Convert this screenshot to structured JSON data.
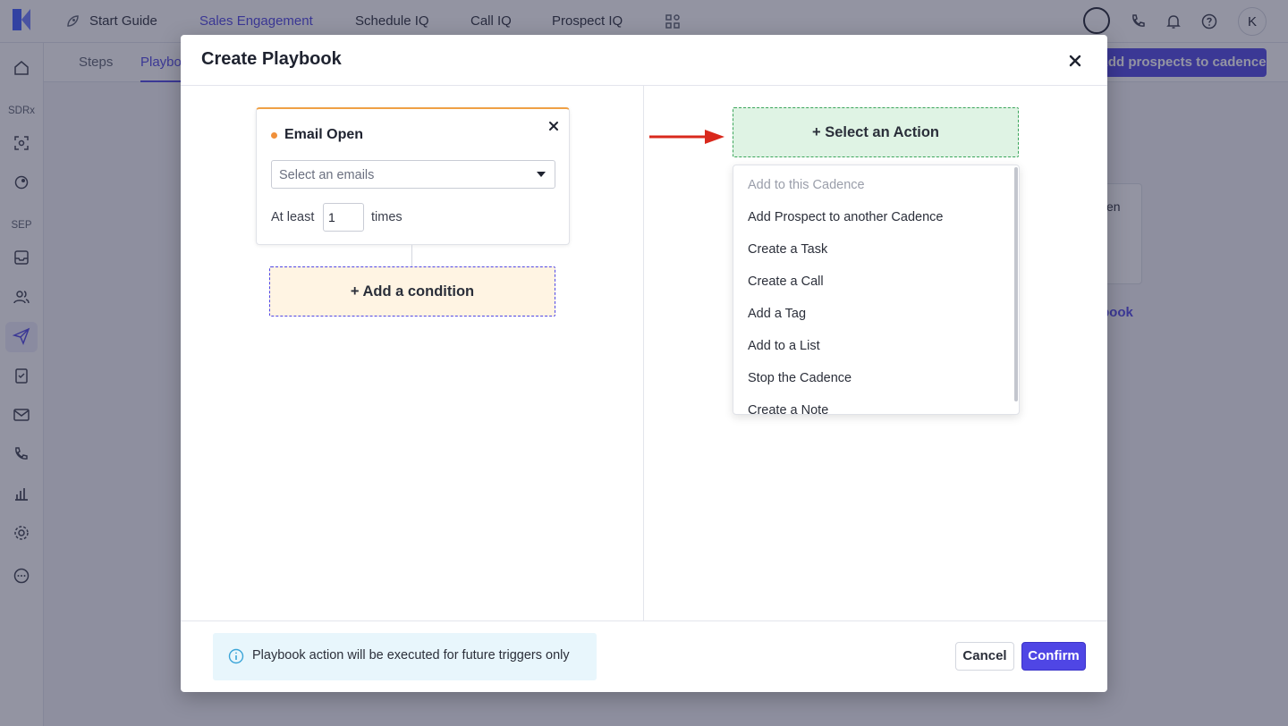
{
  "topnav": {
    "items": [
      "Start Guide",
      "Sales Engagement",
      "Schedule IQ",
      "Call IQ",
      "Prospect IQ"
    ],
    "avatar_initial": "K"
  },
  "sidebar": {
    "section_sdrx": "SDRx",
    "section_sep": "SEP"
  },
  "subnav": {
    "tabs": [
      "Steps",
      "Playbo"
    ],
    "primary_button": "Add prospects to cadence"
  },
  "background": {
    "card_text": "en",
    "link_text": "book"
  },
  "modal": {
    "title": "Create Playbook",
    "trigger": {
      "title": "Email Open",
      "email_select_placeholder": "Select an emails",
      "at_least_label": "At least",
      "at_least_value": "1",
      "times_label": "times"
    },
    "add_condition_label": "+ Add a condition",
    "select_action_label": "+ Select an Action",
    "action_menu": [
      {
        "label": "Add to this Cadence",
        "disabled": true
      },
      {
        "label": "Add Prospect to another Cadence",
        "disabled": false
      },
      {
        "label": "Create a Task",
        "disabled": false
      },
      {
        "label": "Create a Call",
        "disabled": false
      },
      {
        "label": "Add a Tag",
        "disabled": false
      },
      {
        "label": "Add to a List",
        "disabled": false
      },
      {
        "label": "Stop the Cadence",
        "disabled": false
      },
      {
        "label": "Create a Note",
        "disabled": false
      }
    ],
    "info_text": "Playbook action will be executed for future triggers only",
    "cancel_label": "Cancel",
    "confirm_label": "Confirm"
  },
  "colors": {
    "brand": "#4f46e5",
    "trigger_accent": "#f0903a",
    "condition_bg": "#fff4e3",
    "action_bg": "#dff3e4",
    "arrow": "#d9281c",
    "info_bg": "#e8f6fc"
  }
}
